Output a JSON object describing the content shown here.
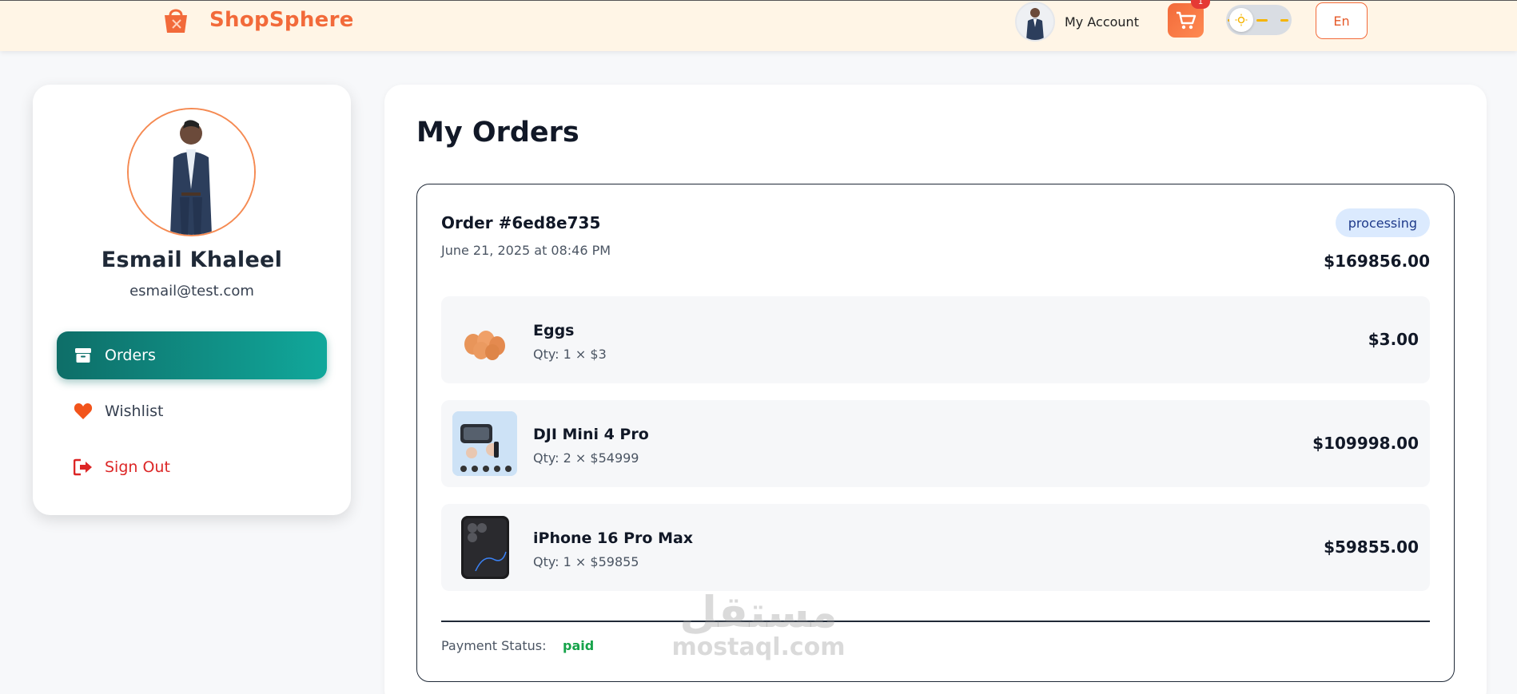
{
  "header": {
    "brand": "ShopSphere",
    "account_label": "My Account",
    "cart_count": "1",
    "language": "En"
  },
  "profile": {
    "name": "Esmail Khaleel",
    "email": "esmail@test.com"
  },
  "nav": {
    "orders": "Orders",
    "wishlist": "Wishlist",
    "signout": "Sign Out"
  },
  "main": {
    "title": "My Orders"
  },
  "order": {
    "id": "Order #6ed8e735",
    "date": "June 21, 2025 at 08:46 PM",
    "status": "processing",
    "total": "$169856.00",
    "items": [
      {
        "name": "Eggs",
        "qty": "Qty: 1 × $3",
        "price": "$3.00"
      },
      {
        "name": "DJI Mini 4 Pro",
        "qty": "Qty: 2 × $54999",
        "price": "$109998.00"
      },
      {
        "name": "iPhone 16 Pro Max",
        "qty": "Qty: 1 × $59855",
        "price": "$59855.00"
      }
    ],
    "payment_label": "Payment Status:",
    "payment_status": "paid"
  },
  "watermark": {
    "arabic": "مستقل",
    "latin": "mostaql.com"
  },
  "colors": {
    "brand": "#f26a3a",
    "nav_active": "#0e6e68",
    "signout": "#dc2626",
    "paid": "#16a34a",
    "status_bg": "#dbeafe"
  }
}
